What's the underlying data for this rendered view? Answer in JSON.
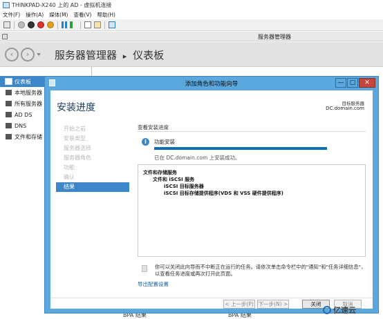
{
  "vm": {
    "title": "THINKPAD-X240 上的 AD - 虚拟机连接",
    "menu": [
      "文件(F)",
      "操作(A)",
      "媒体(M)",
      "查看(V)",
      "帮助(H)"
    ]
  },
  "server_manager": {
    "title": "服务器管理器",
    "breadcrumb_app": "服务器管理器",
    "breadcrumb_sep": "▸",
    "breadcrumb_page": "仪表板",
    "sidebar": [
      {
        "label": "仪表板",
        "icon": "dashboard-icon"
      },
      {
        "label": "本地服务器",
        "icon": "local-server-icon"
      },
      {
        "label": "所有服务器",
        "icon": "all-servers-icon"
      },
      {
        "label": "AD DS",
        "icon": "ad-ds-icon"
      },
      {
        "label": "DNS",
        "icon": "dns-icon"
      },
      {
        "label": "文件和存储",
        "icon": "file-storage-icon"
      }
    ],
    "bottom_left": "BPA 结果",
    "bottom_right": "BPA 结果"
  },
  "wizard": {
    "title": "添加角色和功能向导",
    "window_buttons": [
      "—",
      "▢",
      "✕"
    ],
    "heading": "安装进度",
    "target_label": "目标服务器",
    "target_server": "DC.domain.com",
    "nav": [
      {
        "label": "开始之前",
        "active": false
      },
      {
        "label": "安装类型",
        "active": false
      },
      {
        "label": "服务器选择",
        "active": false
      },
      {
        "label": "服务器角色",
        "active": false
      },
      {
        "label": "功能",
        "active": false
      },
      {
        "label": "确认",
        "active": false
      },
      {
        "label": "结果",
        "active": true
      }
    ],
    "view_progress": "查看安装进度",
    "feature_install": "功能安装",
    "progress": 1.0,
    "install_msg": "已在 DC.domain.com 上安装成功。",
    "results": [
      "文件和存储服务",
      "文件和 iSCSI 服务",
      "iSCSI 目标服务器",
      "iSCSI 目标存储提供程序(VDS 和 VSS 硬件提供程序)"
    ],
    "note": "你可以关闭此向导而不中断正在运行的任务。请依次单击命令栏中的\"通知\"和\"任务详细信息\"，以查看任务进度或再次打开此页面。",
    "export_link": "导出配置设置",
    "buttons": {
      "prev": "< 上一步(P)",
      "next": "下一步(N) >",
      "close": "关闭",
      "cancel": "取消"
    }
  },
  "watermark": "亿速云"
}
